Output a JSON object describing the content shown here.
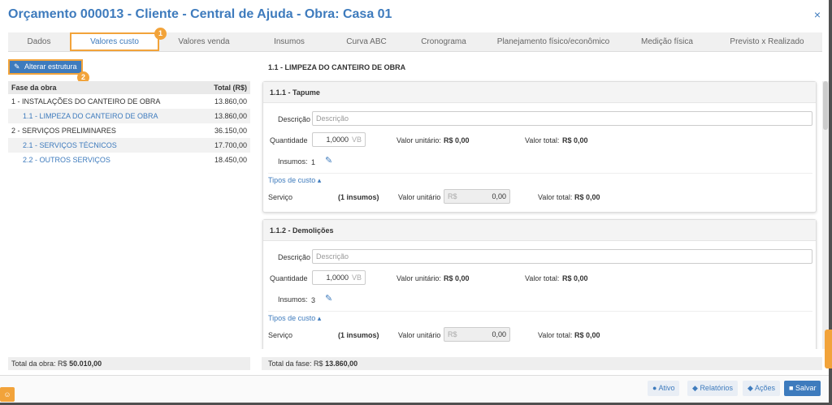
{
  "header": {
    "title": "Orçamento 000013 - Cliente - Central de Ajuda - Obra: Casa 01",
    "close": "×"
  },
  "tabs": [
    {
      "label": "Dados"
    },
    {
      "label": "Valores custo"
    },
    {
      "label": "Valores venda"
    },
    {
      "label": "Insumos"
    },
    {
      "label": "Curva ABC"
    },
    {
      "label": "Cronograma"
    },
    {
      "label": "Planejamento físico/econômico"
    },
    {
      "label": "Medição física"
    },
    {
      "label": "Previsto x Realizado"
    }
  ],
  "callouts": {
    "one": "1",
    "two": "2"
  },
  "left": {
    "alter_button": "Alterar estrutura",
    "col_phase": "Fase da obra",
    "col_total": "Total (R$)",
    "rows": [
      {
        "label": "1 - INSTALAÇÕES DO CANTEIRO DE OBRA",
        "value": "13.860,00"
      },
      {
        "label": "1.1 - LIMPEZA DO CANTEIRO DE OBRA",
        "value": "13.860,00"
      },
      {
        "label": "2 - SERVIÇOS PRELIMINARES",
        "value": "36.150,00"
      },
      {
        "label": "2.1 - SERVIÇOS TÉCNICOS",
        "value": "17.700,00"
      },
      {
        "label": "2.2 - OUTROS SERVIÇOS",
        "value": "18.450,00"
      }
    ],
    "footer_label": "Total da obra: R$",
    "footer_value": "50.010,00"
  },
  "right": {
    "section_title": "1.1 - LIMPEZA DO CANTEIRO DE OBRA",
    "cards": [
      {
        "title": "1.1.1 - Tapume",
        "desc_label": "Descrição",
        "desc_placeholder": "Descrição",
        "qty_label": "Quantidade",
        "qty_value": "1,0000",
        "qty_unit": "VB",
        "unit_label": "Valor unitário:",
        "unit_value": "R$ 0,00",
        "total_label": "Valor total:",
        "total_value": "R$ 0,00",
        "insumos_label": "Insumos:",
        "insumos_count": "1",
        "tipos_label": "Tipos de custo",
        "svc_label": "Serviço",
        "svc_count": "(1 insumos)",
        "svc_unit_label": "Valor unitário",
        "svc_cur": "R$",
        "svc_unit_value": "0,00",
        "svc_total_label": "Valor total:",
        "svc_total_value": "R$ 0,00"
      },
      {
        "title": "1.1.2 - Demolições",
        "desc_label": "Descrição",
        "desc_placeholder": "Descrição",
        "qty_label": "Quantidade",
        "qty_value": "1,0000",
        "qty_unit": "VB",
        "unit_label": "Valor unitário:",
        "unit_value": "R$ 0,00",
        "total_label": "Valor total:",
        "total_value": "R$ 0,00",
        "insumos_label": "Insumos:",
        "insumos_count": "3",
        "tipos_label": "Tipos de custo",
        "svc_label": "Serviço",
        "svc_count": "(1 insumos)",
        "svc_unit_label": "Valor unitário",
        "svc_cur": "R$",
        "svc_unit_value": "0,00",
        "svc_total_label": "Valor total:",
        "svc_total_value": "R$ 0,00"
      }
    ],
    "footer_label": "Total da fase: R$",
    "footer_value": "13.860,00"
  },
  "actions": {
    "ativo": "Ativo",
    "relatorios": "Relatórios",
    "acoes": "Ações",
    "salvar": "Salvar"
  },
  "colors": {
    "accent": "#3e7bbd",
    "highlight": "#f2a33a"
  }
}
